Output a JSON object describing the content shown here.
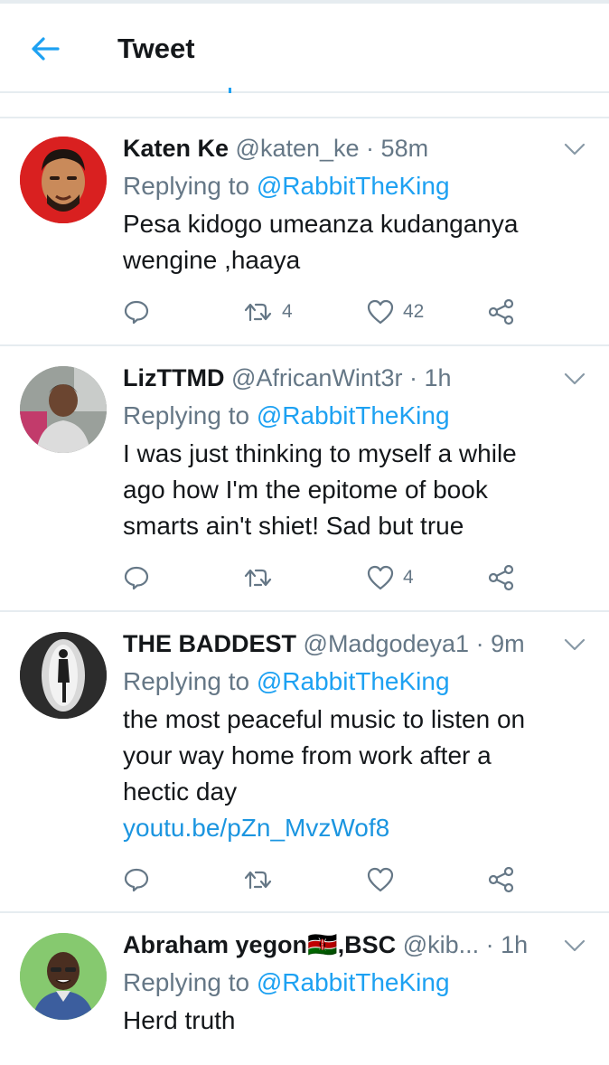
{
  "header": {
    "title": "Tweet"
  },
  "tweets": [
    {
      "name": "Katen Ke",
      "handle": "@katen_ke",
      "time": "58m",
      "replying_label": "Replying to",
      "replying_to": "@RabbitTheKing",
      "lines": [
        "Pesa kidogo umeanza kudanganya",
        "wengine ,haaya"
      ],
      "retweets": "4",
      "likes": "42"
    },
    {
      "name": "LizTTMD",
      "handle": "@AfricanWint3r",
      "time": "1h",
      "replying_label": "Replying to",
      "replying_to": "@RabbitTheKing",
      "lines": [
        "I was just thinking to myself a while",
        "ago how I'm the epitome of book",
        "smarts ain't shiet! Sad but true"
      ],
      "retweets": "",
      "likes": "4"
    },
    {
      "name": "THE BADDEST",
      "handle": "@Madgodeya1",
      "time": "9m",
      "replying_label": "Replying to",
      "replying_to": "@RabbitTheKing",
      "lines": [
        "the most peaceful music to listen on",
        "your way home from work after a",
        "hectic day"
      ],
      "link": "youtu.be/pZn_MvzWof8",
      "retweets": "",
      "likes": ""
    },
    {
      "name": "Abraham yegon🇰🇪,BSC",
      "handle": "@kib...",
      "time": "1h",
      "replying_label": "Replying to",
      "replying_to": "@RabbitTheKing",
      "lines": [
        "Herd truth"
      ]
    }
  ],
  "colors": {
    "accent": "#1da1f2",
    "secondary_text": "#657786",
    "divider": "#e6ecf0"
  },
  "icons": [
    "back-arrow-icon",
    "chevron-down-icon",
    "reply-icon",
    "retweet-icon",
    "like-icon",
    "share-icon"
  ]
}
